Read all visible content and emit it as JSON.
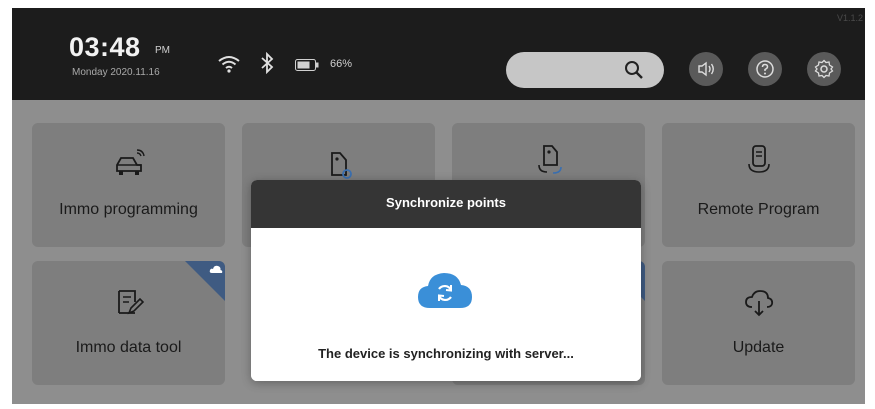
{
  "status": {
    "time": "03:48",
    "ampm": "PM",
    "date": "Monday 2020.11.16",
    "battery": "66%",
    "version": "V1.1.2"
  },
  "icons": {
    "wifi": "wifi-icon",
    "bluetooth": "bluetooth-icon",
    "battery": "battery-icon",
    "search": "search-icon",
    "volume": "volume-icon",
    "help": "help-icon",
    "settings": "gear-icon",
    "cloud_sync": "cloud-sync-icon"
  },
  "tiles": [
    {
      "label": "Immo programming",
      "icon": "car-icon"
    },
    {
      "label": "",
      "icon": "tag-key-icon"
    },
    {
      "label": "",
      "icon": "key-sync-icon"
    },
    {
      "label": "Remote Program",
      "icon": "remote-icon"
    },
    {
      "label": "Immo data tool",
      "icon": "edit-doc-icon",
      "badge": "cloud-badge"
    },
    {
      "label": "",
      "icon": "",
      "badge": "cloud-badge"
    },
    {
      "label": "Update",
      "icon": "cloud-download-icon"
    }
  ],
  "modal": {
    "title": "Synchronize points",
    "message": "The device is synchronizing with server..."
  },
  "colors": {
    "accent": "#3a8fd8",
    "statusbar": "#1c1c1c",
    "overlay": "#8e8e8e"
  }
}
